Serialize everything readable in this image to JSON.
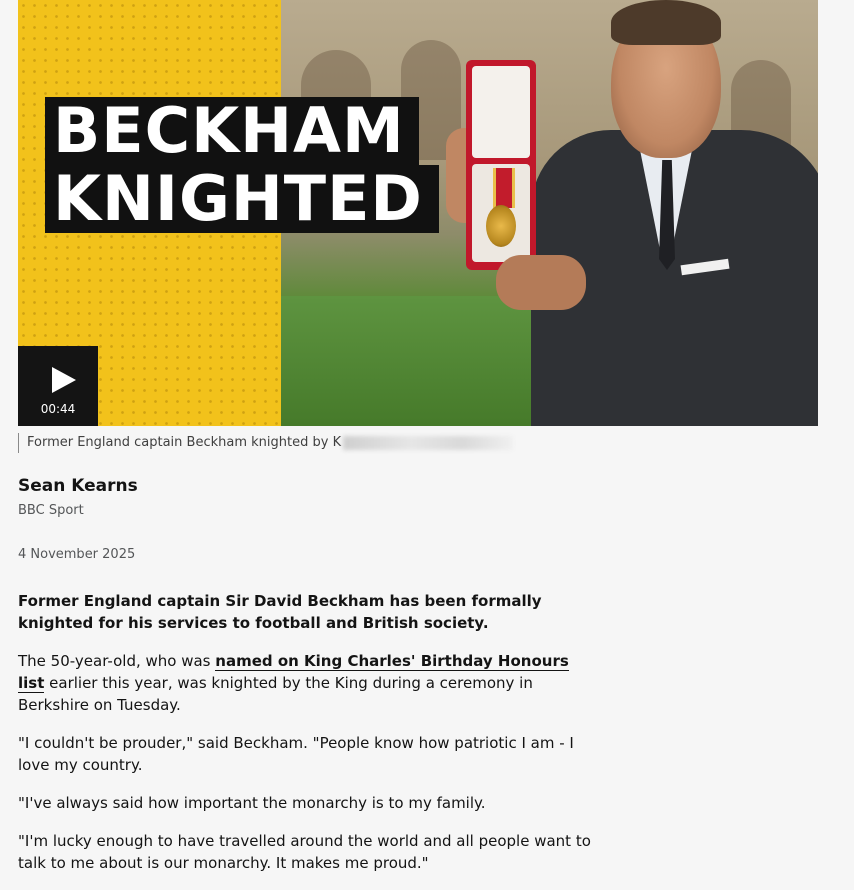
{
  "media": {
    "headline_line1": "BECKHAM",
    "headline_line2": "KNIGHTED",
    "duration": "00:44",
    "caption": "Former England captain Beckham knighted by K"
  },
  "byline": {
    "name": "Sean Kearns",
    "org": "BBC Sport"
  },
  "date": "4 November 2025",
  "article": {
    "lead": "Former England captain Sir David Beckham has been formally knighted for his services to football and British society.",
    "p2_before": "The 50-year-old, who was ",
    "p2_link": "named on King Charles' Birthday Honours list",
    "p2_after": " earlier this year, was knighted by the King during a ceremony in Berkshire on Tuesday.",
    "p3": "\"I couldn't be prouder,\" said Beckham. \"People know how patriotic I am - I love my country.",
    "p4": "\"I've always said how important the monarchy is to my family.",
    "p5": "\"I'm lucky enough to have travelled around the world and all people want to talk to me about is our monarchy. It makes me proud.\""
  },
  "colors": {
    "accent_yellow": "#f2c21b",
    "text": "#141414",
    "muted": "#545658"
  }
}
